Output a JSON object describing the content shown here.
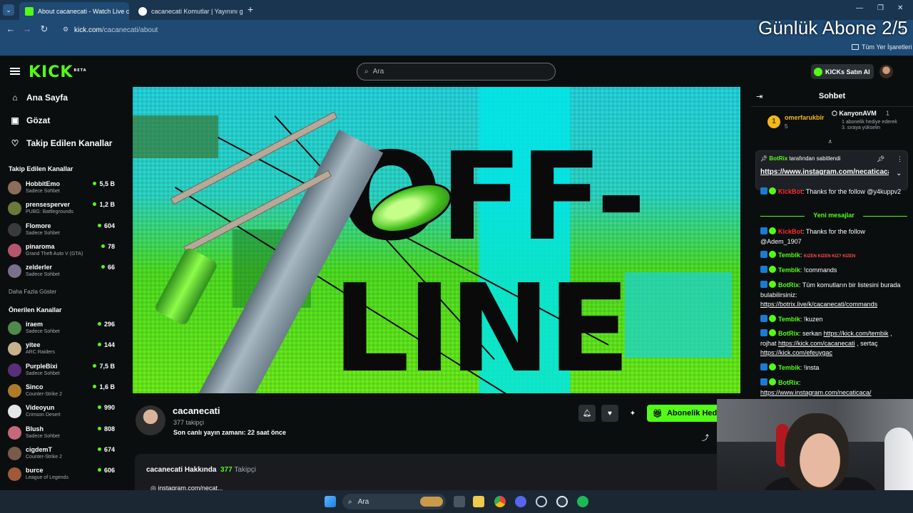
{
  "browser": {
    "tabs": [
      {
        "title": "About cacanecati - Watch Live c",
        "active": true
      },
      {
        "title": "cacanecati Komutlar | Yayınını g",
        "active": false
      }
    ],
    "new_tab": "+",
    "url_domain": "kick.com",
    "url_path": "/cacanecati/about",
    "bookmarks_label": "Tüm Yer İşaretleri"
  },
  "overlay": {
    "title": "Günlük Abone 2/5"
  },
  "header": {
    "logo": "KICK",
    "logo_badge": "BETA",
    "search_placeholder": "Ara",
    "kicks_button": "KICKs Satın Al"
  },
  "sidebar": {
    "nav": [
      {
        "label": "Ana Sayfa",
        "icon": "home-icon"
      },
      {
        "label": "Gözat",
        "icon": "browse-icon"
      },
      {
        "label": "Takip Edilen Kanallar",
        "icon": "heart-icon"
      }
    ],
    "followed_title": "Takip Edilen Kanallar",
    "followed": [
      {
        "name": "HobbitEmo",
        "category": "Sadece Sohbet",
        "viewers": "5,5 B"
      },
      {
        "name": "prensesperver",
        "category": "PUBG: Battlegrounds",
        "viewers": "1,2 B"
      },
      {
        "name": "Flomore",
        "category": "Sadece Sohbet",
        "viewers": "604"
      },
      {
        "name": "pinaroma",
        "category": "Grand Theft Auto V (GTA)",
        "viewers": "78"
      },
      {
        "name": "zelderler",
        "category": "Sadece Sohbet",
        "viewers": "66"
      }
    ],
    "show_more": "Daha Fazla Göster",
    "recommended_title": "Önerilen Kanallar",
    "recommended": [
      {
        "name": "iraem",
        "category": "Sadece Sohbet",
        "viewers": "296"
      },
      {
        "name": "yitee",
        "category": "ARC Raiders",
        "viewers": "144"
      },
      {
        "name": "PurpleBixi",
        "category": "Sadece Sohbet",
        "viewers": "7,5 B"
      },
      {
        "name": "Sinco",
        "category": "Counter-Strike 2",
        "viewers": "1,6 B"
      },
      {
        "name": "Videoyun",
        "category": "Crimson Desert",
        "viewers": "990"
      },
      {
        "name": "Blush",
        "category": "Sadece Sohbet",
        "viewers": "808"
      },
      {
        "name": "cigdemT",
        "category": "Counter-Strike 2",
        "viewers": "674"
      },
      {
        "name": "burce",
        "category": "League of Legends",
        "viewers": "606"
      }
    ]
  },
  "banner": {
    "line1": "OFF-",
    "line2": "LINE"
  },
  "channel": {
    "name": "cacanecati",
    "followers": "377 takipçi",
    "last_live": "Son canlı yayın zamanı: 22 saat önce",
    "subscribe_label": "Abonelik Hediye",
    "about_title": "cacanecati Hakkında",
    "about_count": "377",
    "about_count_label": "Takipçi",
    "instagram": "instagram.com/necat..."
  },
  "chat": {
    "title": "Sohbet",
    "leaderboard": {
      "rank": "1",
      "user": "omerfarukbir",
      "user_count": "5",
      "top_user": "KanyonAVM",
      "top_count": "1",
      "note": "1 abonelik hediye ederek 3. sıraya yükselin"
    },
    "pinned": {
      "by": "BotRix",
      "by_suffix": "tarafından sabitlendi",
      "link": "https://www.instagram.com/necaticaca/"
    },
    "messages_before": [
      {
        "user": "KickBot",
        "text": ": Thanks for the follow @y4kuppv2"
      }
    ],
    "new_messages": "Yeni mesajlar",
    "messages": [
      {
        "user": "KickBot",
        "text": ": Thanks for the follow @Adem_1907",
        "kind": "bot"
      },
      {
        "user": "Tembik",
        "text": ": ",
        "kind": "emotes",
        "emotes": "KIZEN KIZEN KIZ? KIZEN"
      },
      {
        "user": "Tembik",
        "text": ": !commands",
        "kind": "user"
      },
      {
        "user": "BotRix",
        "text": ": Tüm komutların bir listesini burada bulabilirsiniz: ",
        "link": "https://botrix.live/k/cacanecati/commands",
        "kind": "user"
      },
      {
        "user": "Tembik",
        "text": ": !kuzen",
        "kind": "user"
      },
      {
        "user": "BotRix",
        "text": ": serkan ",
        "links": [
          "https://kick.com/tembik",
          "https://kick.com/cacanecati",
          "https://kick.com/efeuygac"
        ],
        "mid1": " , rojhat ",
        "mid2": " , sertaç ",
        "kind": "user"
      },
      {
        "user": "Tembik",
        "text": ": !insta",
        "kind": "user"
      },
      {
        "user": "BotRix",
        "text": ":",
        "link": "https://www.instagram.com/necaticaca/",
        "kind": "user"
      }
    ]
  },
  "taskbar": {
    "search": "Ara"
  },
  "colors": {
    "accent": "#53fc18",
    "bg": "#0b0e0f",
    "chrome": "#1f4a73"
  }
}
